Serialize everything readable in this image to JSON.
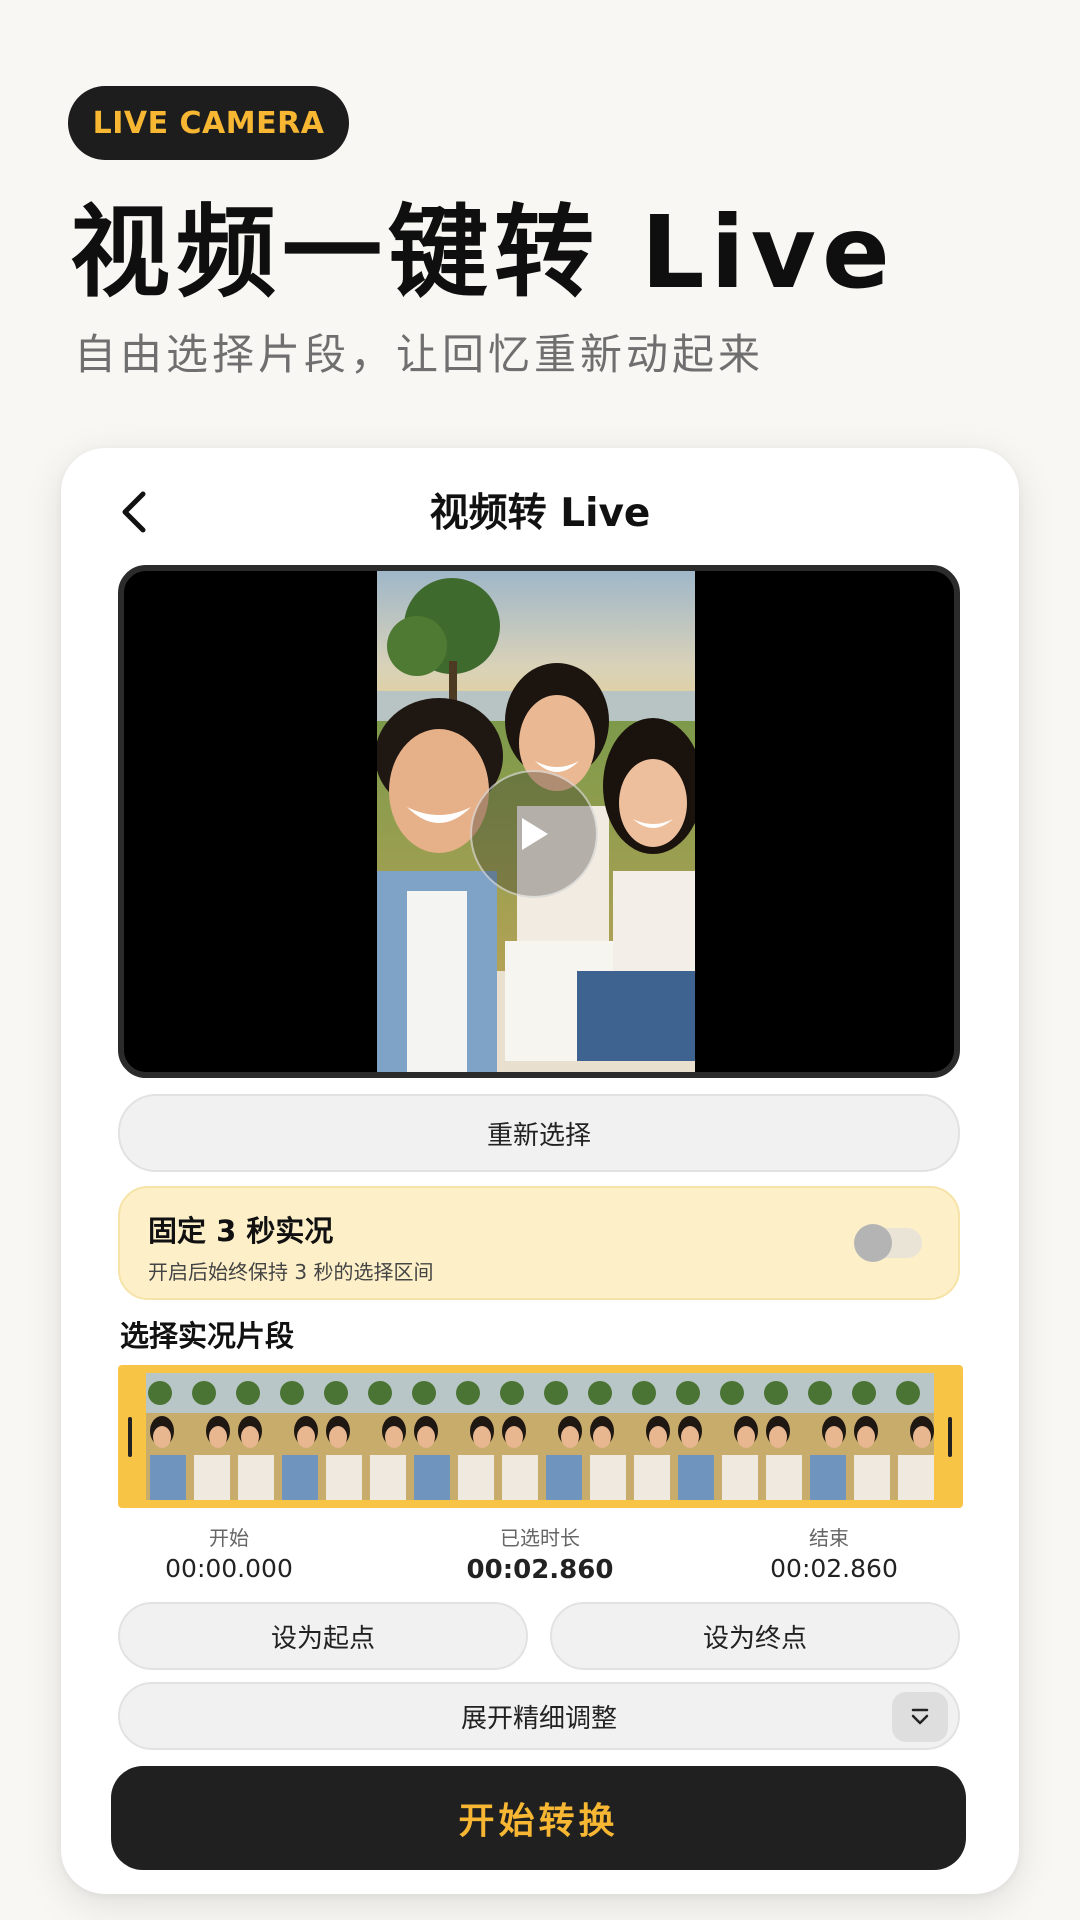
{
  "badge": {
    "label": "LIVE CAMERA"
  },
  "hero": {
    "title": "视频一键转 Live",
    "subtitle": "自由选择片段，让回忆重新动起来"
  },
  "nav": {
    "title": "视频转 Live",
    "back_icon": "chevron-left-icon"
  },
  "player": {
    "play_icon": "play-icon"
  },
  "buttons": {
    "reselect": "重新选择",
    "set_start": "设为起点",
    "set_end": "设为终点",
    "expand": "展开精细调整",
    "expand_icon": "chevron-down-icon",
    "start": "开始转换"
  },
  "fixed_mode": {
    "title": "固定 3 秒实况",
    "description": "开启后始终保持 3 秒的选择区间",
    "enabled": false
  },
  "segment": {
    "title": "选择实况片段",
    "start_label": "开始",
    "start_value": "00:00.000",
    "duration_label": "已选时长",
    "duration_value": "00:02.860",
    "end_label": "结束",
    "end_value": "00:02.860"
  },
  "colors": {
    "accent": "#f7b733",
    "dark": "#1d1d1d",
    "highlight_bg": "#fdf0c9",
    "timeline": "#f8c445"
  }
}
